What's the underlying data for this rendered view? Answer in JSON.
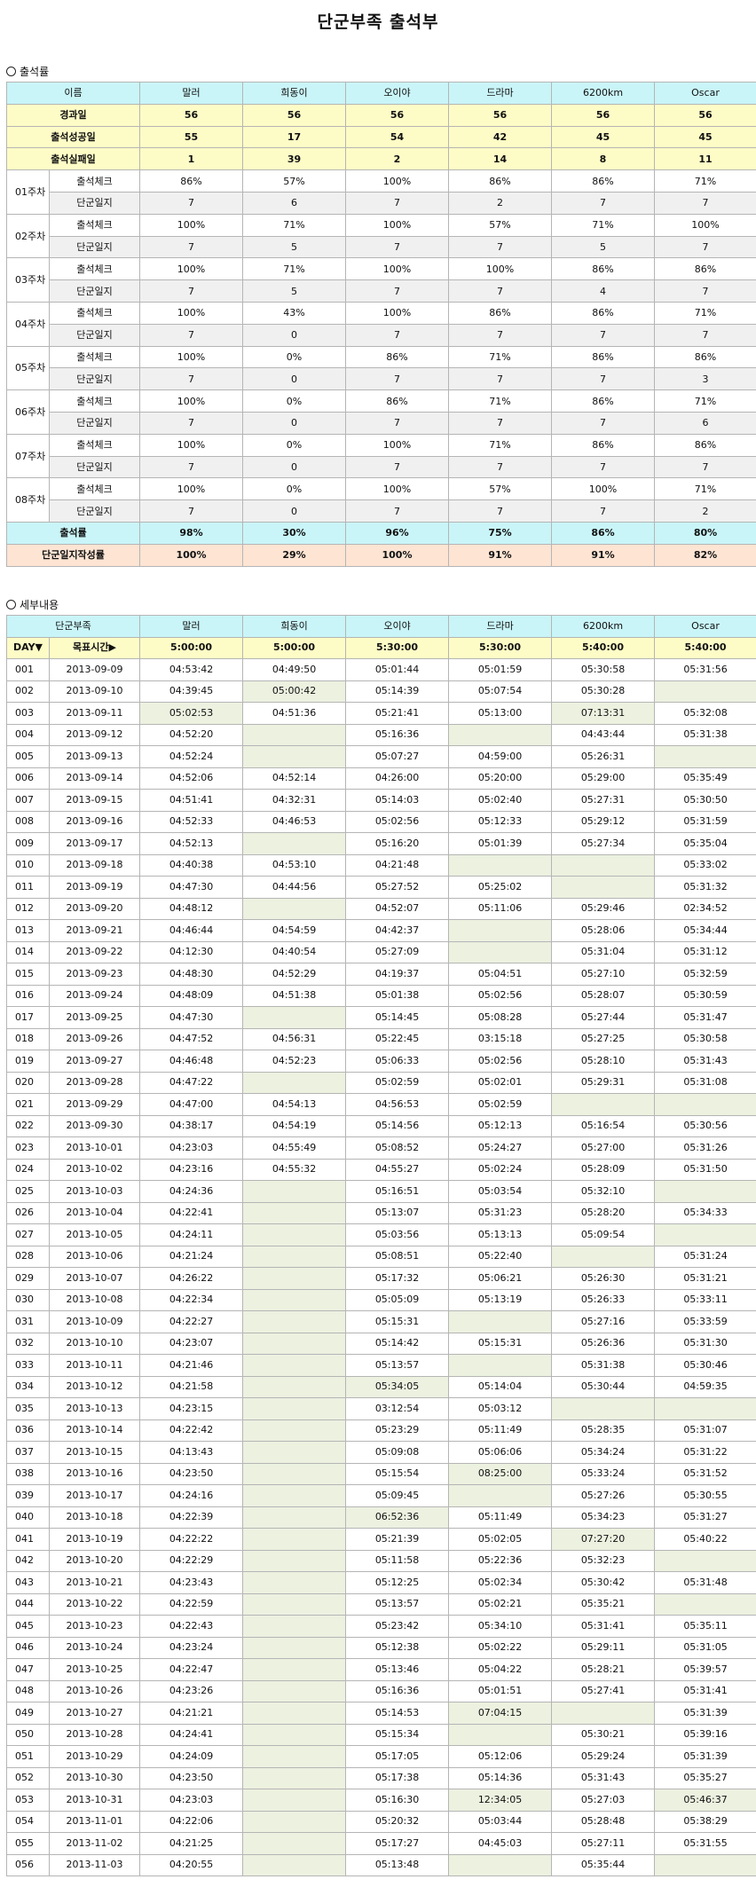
{
  "page_title": "단군부족 출석부",
  "section1_title": "출석률",
  "section2_title": "세부내용",
  "rate_table": {
    "header_label": "이름",
    "members": [
      "말러",
      "희동이",
      "오이야",
      "드라마",
      "6200km",
      "Oscar"
    ],
    "summary_rows": [
      {
        "label": "경과일",
        "values": [
          "56",
          "56",
          "56",
          "56",
          "56",
          "56"
        ]
      },
      {
        "label": "출석성공일",
        "values": [
          "55",
          "17",
          "54",
          "42",
          "45",
          "45"
        ]
      },
      {
        "label": "출석실패일",
        "values": [
          "1",
          "39",
          "2",
          "14",
          "8",
          "11"
        ]
      }
    ],
    "check_label": "출석체크",
    "diary_label": "단군일지",
    "weeks": [
      {
        "label": "01주차",
        "check": [
          "86%",
          "57%",
          "100%",
          "86%",
          "86%",
          "71%"
        ],
        "diary": [
          "7",
          "6",
          "7",
          "2",
          "7",
          "7"
        ]
      },
      {
        "label": "02주차",
        "check": [
          "100%",
          "71%",
          "100%",
          "57%",
          "71%",
          "100%"
        ],
        "diary": [
          "7",
          "5",
          "7",
          "7",
          "5",
          "7"
        ]
      },
      {
        "label": "03주차",
        "check": [
          "100%",
          "71%",
          "100%",
          "100%",
          "86%",
          "86%"
        ],
        "diary": [
          "7",
          "5",
          "7",
          "7",
          "4",
          "7"
        ]
      },
      {
        "label": "04주차",
        "check": [
          "100%",
          "43%",
          "100%",
          "86%",
          "86%",
          "71%"
        ],
        "diary": [
          "7",
          "0",
          "7",
          "7",
          "7",
          "7"
        ]
      },
      {
        "label": "05주차",
        "check": [
          "100%",
          "0%",
          "86%",
          "71%",
          "86%",
          "86%"
        ],
        "diary": [
          "7",
          "0",
          "7",
          "7",
          "7",
          "3"
        ]
      },
      {
        "label": "06주차",
        "check": [
          "100%",
          "0%",
          "86%",
          "71%",
          "86%",
          "71%"
        ],
        "diary": [
          "7",
          "0",
          "7",
          "7",
          "7",
          "6"
        ]
      },
      {
        "label": "07주차",
        "check": [
          "100%",
          "0%",
          "100%",
          "71%",
          "86%",
          "86%"
        ],
        "diary": [
          "7",
          "0",
          "7",
          "7",
          "7",
          "7"
        ]
      },
      {
        "label": "08주차",
        "check": [
          "100%",
          "0%",
          "100%",
          "57%",
          "100%",
          "71%"
        ],
        "diary": [
          "7",
          "0",
          "7",
          "7",
          "7",
          "2"
        ]
      }
    ],
    "attendance_rate": {
      "label": "출석률",
      "values": [
        "98%",
        "30%",
        "96%",
        "75%",
        "86%",
        "80%"
      ]
    },
    "diary_rate": {
      "label": "단군일지작성률",
      "values": [
        "100%",
        "29%",
        "100%",
        "91%",
        "91%",
        "82%"
      ]
    }
  },
  "detail_table": {
    "header_label": "단군부족",
    "day_label": "DAY▼",
    "target_label": "목표시간▶",
    "targets": [
      "5:00:00",
      "5:00:00",
      "5:30:00",
      "5:30:00",
      "5:40:00",
      "5:40:00"
    ],
    "rows": [
      [
        "001",
        "2013-09-09",
        "04:53:42",
        "04:49:50",
        "05:01:44",
        "05:01:59",
        "05:30:58",
        "05:31:56"
      ],
      [
        "002",
        "2013-09-10",
        "04:39:45",
        "05:00:42",
        "05:14:39",
        "05:07:54",
        "05:30:28",
        ""
      ],
      [
        "003",
        "2013-09-11",
        "05:02:53",
        "04:51:36",
        "05:21:41",
        "05:13:00",
        "07:13:31",
        "05:32:08"
      ],
      [
        "004",
        "2013-09-12",
        "04:52:20",
        "",
        "05:16:36",
        "",
        "04:43:44",
        "05:31:38"
      ],
      [
        "005",
        "2013-09-13",
        "04:52:24",
        "",
        "05:07:27",
        "04:59:00",
        "05:26:31",
        ""
      ],
      [
        "006",
        "2013-09-14",
        "04:52:06",
        "04:52:14",
        "04:26:00",
        "05:20:00",
        "05:29:00",
        "05:35:49"
      ],
      [
        "007",
        "2013-09-15",
        "04:51:41",
        "04:32:31",
        "05:14:03",
        "05:02:40",
        "05:27:31",
        "05:30:50"
      ],
      [
        "008",
        "2013-09-16",
        "04:52:33",
        "04:46:53",
        "05:02:56",
        "05:12:33",
        "05:29:12",
        "05:31:59"
      ],
      [
        "009",
        "2013-09-17",
        "04:52:13",
        "",
        "05:16:20",
        "05:01:39",
        "05:27:34",
        "05:35:04"
      ],
      [
        "010",
        "2013-09-18",
        "04:40:38",
        "04:53:10",
        "04:21:48",
        "",
        "",
        "05:33:02"
      ],
      [
        "011",
        "2013-09-19",
        "04:47:30",
        "04:44:56",
        "05:27:52",
        "05:25:02",
        "",
        "05:31:32"
      ],
      [
        "012",
        "2013-09-20",
        "04:48:12",
        "",
        "04:52:07",
        "05:11:06",
        "05:29:46",
        "02:34:52"
      ],
      [
        "013",
        "2013-09-21",
        "04:46:44",
        "04:54:59",
        "04:42:37",
        "",
        "05:28:06",
        "05:34:44"
      ],
      [
        "014",
        "2013-09-22",
        "04:12:30",
        "04:40:54",
        "05:27:09",
        "",
        "05:31:04",
        "05:31:12"
      ],
      [
        "015",
        "2013-09-23",
        "04:48:30",
        "04:52:29",
        "04:19:37",
        "05:04:51",
        "05:27:10",
        "05:32:59"
      ],
      [
        "016",
        "2013-09-24",
        "04:48:09",
        "04:51:38",
        "05:01:38",
        "05:02:56",
        "05:28:07",
        "05:30:59"
      ],
      [
        "017",
        "2013-09-25",
        "04:47:30",
        "",
        "05:14:45",
        "05:08:28",
        "05:27:44",
        "05:31:47"
      ],
      [
        "018",
        "2013-09-26",
        "04:47:52",
        "04:56:31",
        "05:22:45",
        "03:15:18",
        "05:27:25",
        "05:30:58"
      ],
      [
        "019",
        "2013-09-27",
        "04:46:48",
        "04:52:23",
        "05:06:33",
        "05:02:56",
        "05:28:10",
        "05:31:43"
      ],
      [
        "020",
        "2013-09-28",
        "04:47:22",
        "",
        "05:02:59",
        "05:02:01",
        "05:29:31",
        "05:31:08"
      ],
      [
        "021",
        "2013-09-29",
        "04:47:00",
        "04:54:13",
        "04:56:53",
        "05:02:59",
        "",
        ""
      ],
      [
        "022",
        "2013-09-30",
        "04:38:17",
        "04:54:19",
        "05:14:56",
        "05:12:13",
        "05:16:54",
        "05:30:56"
      ],
      [
        "023",
        "2013-10-01",
        "04:23:03",
        "04:55:49",
        "05:08:52",
        "05:24:27",
        "05:27:00",
        "05:31:26"
      ],
      [
        "024",
        "2013-10-02",
        "04:23:16",
        "04:55:32",
        "04:55:27",
        "05:02:24",
        "05:28:09",
        "05:31:50"
      ],
      [
        "025",
        "2013-10-03",
        "04:24:36",
        "",
        "05:16:51",
        "05:03:54",
        "05:32:10",
        ""
      ],
      [
        "026",
        "2013-10-04",
        "04:22:41",
        "",
        "05:13:07",
        "05:31:23",
        "05:28:20",
        "05:34:33"
      ],
      [
        "027",
        "2013-10-05",
        "04:24:11",
        "",
        "05:03:56",
        "05:13:13",
        "05:09:54",
        ""
      ],
      [
        "028",
        "2013-10-06",
        "04:21:24",
        "",
        "05:08:51",
        "05:22:40",
        "",
        "05:31:24"
      ],
      [
        "029",
        "2013-10-07",
        "04:26:22",
        "",
        "05:17:32",
        "05:06:21",
        "05:26:30",
        "05:31:21"
      ],
      [
        "030",
        "2013-10-08",
        "04:22:34",
        "",
        "05:05:09",
        "05:13:19",
        "05:26:33",
        "05:33:11"
      ],
      [
        "031",
        "2013-10-09",
        "04:22:27",
        "",
        "05:15:31",
        "",
        "05:27:16",
        "05:33:59"
      ],
      [
        "032",
        "2013-10-10",
        "04:23:07",
        "",
        "05:14:42",
        "05:15:31",
        "05:26:36",
        "05:31:30"
      ],
      [
        "033",
        "2013-10-11",
        "04:21:46",
        "",
        "05:13:57",
        "",
        "05:31:38",
        "05:30:46"
      ],
      [
        "034",
        "2013-10-12",
        "04:21:58",
        "",
        "05:34:05",
        "05:14:04",
        "05:30:44",
        "04:59:35"
      ],
      [
        "035",
        "2013-10-13",
        "04:23:15",
        "",
        "03:12:54",
        "05:03:12",
        "",
        ""
      ],
      [
        "036",
        "2013-10-14",
        "04:22:42",
        "",
        "05:23:29",
        "05:11:49",
        "05:28:35",
        "05:31:07"
      ],
      [
        "037",
        "2013-10-15",
        "04:13:43",
        "",
        "05:09:08",
        "05:06:06",
        "05:34:24",
        "05:31:22"
      ],
      [
        "038",
        "2013-10-16",
        "04:23:50",
        "",
        "05:15:54",
        "08:25:00",
        "05:33:24",
        "05:31:52"
      ],
      [
        "039",
        "2013-10-17",
        "04:24:16",
        "",
        "05:09:45",
        "",
        "05:27:26",
        "05:30:55"
      ],
      [
        "040",
        "2013-10-18",
        "04:22:39",
        "",
        "06:52:36",
        "05:11:49",
        "05:34:23",
        "05:31:27"
      ],
      [
        "041",
        "2013-10-19",
        "04:22:22",
        "",
        "05:21:39",
        "05:02:05",
        "07:27:20",
        "05:40:22"
      ],
      [
        "042",
        "2013-10-20",
        "04:22:29",
        "",
        "05:11:58",
        "05:22:36",
        "05:32:23",
        ""
      ],
      [
        "043",
        "2013-10-21",
        "04:23:43",
        "",
        "05:12:25",
        "05:02:34",
        "05:30:42",
        "05:31:48"
      ],
      [
        "044",
        "2013-10-22",
        "04:22:59",
        "",
        "05:13:57",
        "05:02:21",
        "05:35:21",
        ""
      ],
      [
        "045",
        "2013-10-23",
        "04:22:43",
        "",
        "05:23:42",
        "05:34:10",
        "05:31:41",
        "05:35:11"
      ],
      [
        "046",
        "2013-10-24",
        "04:23:24",
        "",
        "05:12:38",
        "05:02:22",
        "05:29:11",
        "05:31:05"
      ],
      [
        "047",
        "2013-10-25",
        "04:22:47",
        "",
        "05:13:46",
        "05:04:22",
        "05:28:21",
        "05:39:57"
      ],
      [
        "048",
        "2013-10-26",
        "04:23:26",
        "",
        "05:16:36",
        "05:01:51",
        "05:27:41",
        "05:31:41"
      ],
      [
        "049",
        "2013-10-27",
        "04:21:21",
        "",
        "05:14:53",
        "07:04:15",
        "",
        "05:31:39"
      ],
      [
        "050",
        "2013-10-28",
        "04:24:41",
        "",
        "05:15:34",
        "",
        "05:30:21",
        "05:39:16"
      ],
      [
        "051",
        "2013-10-29",
        "04:24:09",
        "",
        "05:17:05",
        "05:12:06",
        "05:29:24",
        "05:31:39"
      ],
      [
        "052",
        "2013-10-30",
        "04:23:50",
        "",
        "05:17:38",
        "05:14:36",
        "05:31:43",
        "05:35:27"
      ],
      [
        "053",
        "2013-10-31",
        "04:23:03",
        "",
        "05:16:30",
        "12:34:05",
        "05:27:03",
        "05:46:37"
      ],
      [
        "054",
        "2013-11-01",
        "04:22:06",
        "",
        "05:20:32",
        "05:03:44",
        "05:28:48",
        "05:38:29"
      ],
      [
        "055",
        "2013-11-02",
        "04:21:25",
        "",
        "05:17:27",
        "04:45:03",
        "05:27:11",
        "05:31:55"
      ],
      [
        "056",
        "2013-11-03",
        "04:20:55",
        "",
        "05:13:48",
        "",
        "05:35:44",
        ""
      ]
    ],
    "miss_cells": [
      [
        1,
        3
      ],
      [
        1,
        7
      ],
      [
        2,
        2
      ],
      [
        2,
        6
      ],
      [
        3,
        3
      ],
      [
        3,
        5
      ],
      [
        4,
        3
      ],
      [
        4,
        7
      ],
      [
        8,
        3
      ],
      [
        9,
        5
      ],
      [
        9,
        6
      ],
      [
        10,
        6
      ],
      [
        11,
        3
      ],
      [
        12,
        5
      ],
      [
        13,
        5
      ],
      [
        16,
        3
      ],
      [
        19,
        3
      ],
      [
        20,
        6
      ],
      [
        20,
        7
      ],
      [
        24,
        3
      ],
      [
        24,
        7
      ],
      [
        25,
        3
      ],
      [
        26,
        3
      ],
      [
        26,
        7
      ],
      [
        27,
        3
      ],
      [
        27,
        6
      ],
      [
        28,
        3
      ],
      [
        29,
        3
      ],
      [
        30,
        3
      ],
      [
        30,
        5
      ],
      [
        31,
        3
      ],
      [
        32,
        3
      ],
      [
        32,
        5
      ],
      [
        33,
        3
      ],
      [
        33,
        4
      ],
      [
        34,
        3
      ],
      [
        34,
        6
      ],
      [
        34,
        7
      ],
      [
        35,
        3
      ],
      [
        36,
        3
      ],
      [
        37,
        3
      ],
      [
        37,
        5
      ],
      [
        38,
        3
      ],
      [
        38,
        5
      ],
      [
        39,
        3
      ],
      [
        39,
        4
      ],
      [
        40,
        3
      ],
      [
        40,
        6
      ],
      [
        41,
        3
      ],
      [
        41,
        7
      ],
      [
        42,
        3
      ],
      [
        43,
        3
      ],
      [
        43,
        7
      ],
      [
        44,
        3
      ],
      [
        45,
        3
      ],
      [
        46,
        3
      ],
      [
        47,
        3
      ],
      [
        48,
        3
      ],
      [
        48,
        5
      ],
      [
        48,
        6
      ],
      [
        49,
        3
      ],
      [
        49,
        5
      ],
      [
        50,
        3
      ],
      [
        51,
        3
      ],
      [
        52,
        3
      ],
      [
        52,
        5
      ],
      [
        52,
        7
      ],
      [
        53,
        3
      ],
      [
        54,
        3
      ],
      [
        55,
        3
      ],
      [
        55,
        5
      ],
      [
        55,
        7
      ]
    ]
  }
}
